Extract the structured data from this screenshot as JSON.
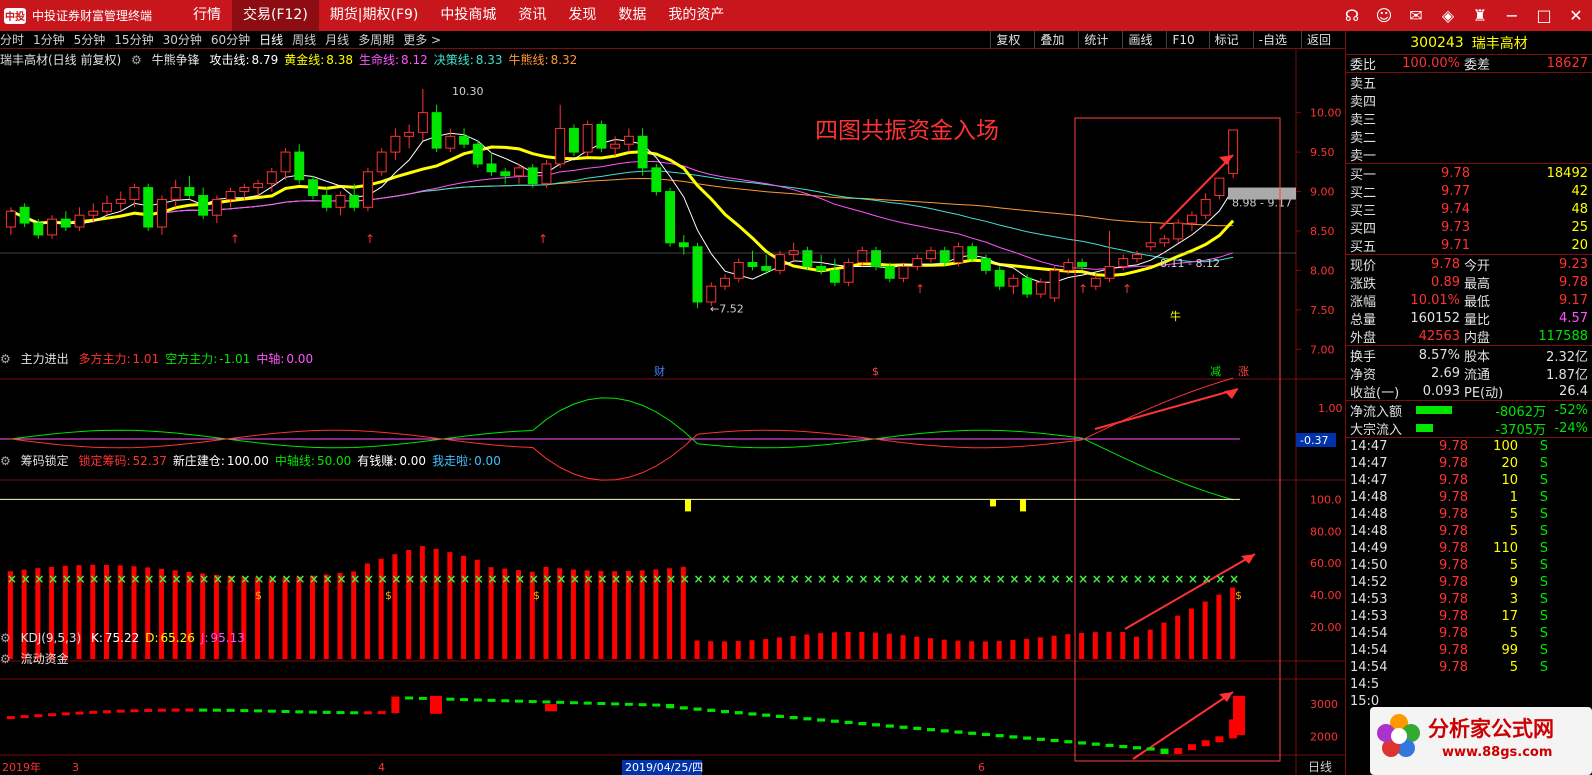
{
  "app": {
    "title": "中投证券财富管理终端",
    "menu": [
      "行情",
      "交易(F12)",
      "期货|期权(F9)",
      "中投商城",
      "资讯",
      "发现",
      "数据",
      "我的资产"
    ],
    "active_menu": 1
  },
  "timeframes": [
    "分时",
    "1分钟",
    "5分钟",
    "15分钟",
    "30分钟",
    "60分钟",
    "日线",
    "周线",
    "月线",
    "多周期",
    "更多 >"
  ],
  "selected_timeframe": "日线",
  "tools": [
    "复权",
    "叠加",
    "统计",
    "画线",
    "F10",
    "标记",
    "-自选",
    "返回"
  ],
  "main_panel": {
    "title": "瑞丰高材(日线 前复权)",
    "indicator": "牛熊争锋",
    "lines": [
      {
        "label": "攻击线:",
        "value": "8.79",
        "color": "#ffffff"
      },
      {
        "label": "黄金线:",
        "value": "8.38",
        "color": "#ffff00"
      },
      {
        "label": "生命线:",
        "value": "8.12",
        "color": "#ff55ff"
      },
      {
        "label": "决策线:",
        "value": "8.33",
        "color": "#40e0d0"
      },
      {
        "label": "牛熊线:",
        "value": "8.32",
        "color": "#ff9933"
      }
    ],
    "annotation": "四图共振资金入场",
    "high_label": "10.30",
    "low_label": "7.52",
    "range1": "8.98 - 9.17",
    "range2": "8.11 - 8.12",
    "marks": [
      "财",
      "$",
      "减",
      "涨",
      "牛"
    ],
    "yticks": [
      "10.00",
      "9.50",
      "9.00",
      "8.50",
      "8.00",
      "7.50",
      "7.00"
    ]
  },
  "panel2": {
    "title": "主力进出",
    "items": [
      {
        "label": "多方主力:",
        "value": "1.01",
        "color": "#ff3232"
      },
      {
        "label": "空方主力:",
        "value": "-1.01",
        "color": "#00e600"
      },
      {
        "label": "中轴:",
        "value": "0.00",
        "color": "#ff55ff"
      }
    ],
    "yticks": [
      "1.00",
      "-0.37"
    ]
  },
  "panel3": {
    "title": "筹码锁定",
    "items": [
      {
        "label": "锁定筹码:",
        "value": "52.37",
        "color": "#ff3232"
      },
      {
        "label": "新庄建仓:",
        "value": "100.00",
        "color": "#ffffff"
      },
      {
        "label": "中轴线:",
        "value": "50.00",
        "color": "#00e600"
      },
      {
        "label": "有钱赚:",
        "value": "0.00",
        "color": "#ffffff"
      },
      {
        "label": "我走啦:",
        "value": "0.00",
        "color": "#40c0ff"
      }
    ],
    "yticks": [
      "100.0",
      "80.00",
      "60.00",
      "40.00",
      "20.00"
    ]
  },
  "panel4": {
    "title": "KDJ(9,5,3)",
    "items": [
      {
        "label": "K:",
        "value": "75.22",
        "color": "#ffffff"
      },
      {
        "label": "D:",
        "value": "65.26",
        "color": "#ffff00"
      },
      {
        "label": "J:",
        "value": "95.13",
        "color": "#ff55ff"
      }
    ]
  },
  "panel5": {
    "title": "流动资金",
    "yticks": [
      "3000",
      "2000"
    ]
  },
  "xaxis": {
    "labels": [
      "2019年",
      "3",
      "4",
      "2019/04/25/四",
      "6"
    ],
    "period": "日线"
  },
  "quote": {
    "code": "300243",
    "name": "瑞丰高材",
    "weibi": {
      "label": "委比",
      "value": "100.00%",
      "label2": "委差",
      "value2": "18627"
    },
    "asks": [
      "卖五",
      "卖四",
      "卖三",
      "卖二",
      "卖一"
    ],
    "bids": [
      {
        "label": "买一",
        "price": "9.78",
        "vol": "18492"
      },
      {
        "label": "买二",
        "price": "9.77",
        "vol": "42"
      },
      {
        "label": "买三",
        "price": "9.74",
        "vol": "48"
      },
      {
        "label": "买四",
        "price": "9.73",
        "vol": "25"
      },
      {
        "label": "买五",
        "price": "9.71",
        "vol": "20"
      }
    ],
    "stats": [
      {
        "l1": "现价",
        "v1": "9.78",
        "c1": "red",
        "l2": "今开",
        "v2": "9.23",
        "c2": "red"
      },
      {
        "l1": "涨跌",
        "v1": "0.89",
        "c1": "red",
        "l2": "最高",
        "v2": "9.78",
        "c2": "red"
      },
      {
        "l1": "涨幅",
        "v1": "10.01%",
        "c1": "red",
        "l2": "最低",
        "v2": "9.17",
        "c2": "red"
      },
      {
        "l1": "总量",
        "v1": "160152",
        "c1": "white",
        "l2": "量比",
        "v2": "4.57",
        "c2": "purple"
      },
      {
        "l1": "外盘",
        "v1": "42563",
        "c1": "red",
        "l2": "内盘",
        "v2": "117588",
        "c2": "green"
      }
    ],
    "stats2": [
      {
        "l1": "换手",
        "v1": "8.57%",
        "l2": "股本",
        "v2": "2.32亿"
      },
      {
        "l1": "净资",
        "v1": "2.69",
        "l2": "流通",
        "v2": "1.87亿"
      },
      {
        "l1": "收益(一)",
        "v1": "0.093",
        "l2": "PE(动)",
        "v2": "26.4"
      }
    ],
    "flows": [
      {
        "label": "净流入额",
        "value": "-8062万",
        "pct": "-52%",
        "bar": 0.52
      },
      {
        "label": "大宗流入",
        "value": "-3705万",
        "pct": "-24%",
        "bar": 0.24
      }
    ],
    "ticks": [
      {
        "t": "14:47",
        "p": "9.78",
        "v": "100",
        "s": "S"
      },
      {
        "t": "14:47",
        "p": "9.78",
        "v": "20",
        "s": "S"
      },
      {
        "t": "14:47",
        "p": "9.78",
        "v": "10",
        "s": "S"
      },
      {
        "t": "14:48",
        "p": "9.78",
        "v": "1",
        "s": "S"
      },
      {
        "t": "14:48",
        "p": "9.78",
        "v": "5",
        "s": "S"
      },
      {
        "t": "14:48",
        "p": "9.78",
        "v": "5",
        "s": "S"
      },
      {
        "t": "14:49",
        "p": "9.78",
        "v": "110",
        "s": "S"
      },
      {
        "t": "14:50",
        "p": "9.78",
        "v": "5",
        "s": "S"
      },
      {
        "t": "14:52",
        "p": "9.78",
        "v": "9",
        "s": "S"
      },
      {
        "t": "14:53",
        "p": "9.78",
        "v": "3",
        "s": "S"
      },
      {
        "t": "14:53",
        "p": "9.78",
        "v": "17",
        "s": "S"
      },
      {
        "t": "14:54",
        "p": "9.78",
        "v": "5",
        "s": "S"
      },
      {
        "t": "14:54",
        "p": "9.78",
        "v": "99",
        "s": "S"
      },
      {
        "t": "14:54",
        "p": "9.78",
        "v": "5",
        "s": "S"
      },
      {
        "t": "14:5",
        "p": "",
        "v": "",
        "s": ""
      },
      {
        "t": "15:0",
        "p": "",
        "v": "",
        "s": ""
      }
    ]
  },
  "watermark": {
    "text": "分析家公式网",
    "url": "www.88gs.com"
  },
  "chart_data": {
    "type": "candlestick",
    "ohlc": [
      [
        8.55,
        8.8,
        8.45,
        8.75
      ],
      [
        8.8,
        8.85,
        8.55,
        8.6
      ],
      [
        8.6,
        8.65,
        8.4,
        8.45
      ],
      [
        8.45,
        8.7,
        8.4,
        8.65
      ],
      [
        8.65,
        8.75,
        8.5,
        8.55
      ],
      [
        8.55,
        8.8,
        8.5,
        8.7
      ],
      [
        8.7,
        8.85,
        8.6,
        8.75
      ],
      [
        8.75,
        8.95,
        8.7,
        8.85
      ],
      [
        8.85,
        9.0,
        8.75,
        8.9
      ],
      [
        8.9,
        9.1,
        8.8,
        9.05
      ],
      [
        9.05,
        9.1,
        8.5,
        8.55
      ],
      [
        8.55,
        8.95,
        8.45,
        8.9
      ],
      [
        8.9,
        9.15,
        8.8,
        9.05
      ],
      [
        9.05,
        9.2,
        8.9,
        8.95
      ],
      [
        8.95,
        9.05,
        8.65,
        8.7
      ],
      [
        8.7,
        8.95,
        8.6,
        8.9
      ],
      [
        8.9,
        9.05,
        8.8,
        9.0
      ],
      [
        9.0,
        9.1,
        8.9,
        9.05
      ],
      [
        9.05,
        9.15,
        8.95,
        9.1
      ],
      [
        9.1,
        9.3,
        9.0,
        9.25
      ],
      [
        9.25,
        9.55,
        9.15,
        9.5
      ],
      [
        9.5,
        9.6,
        9.1,
        9.15
      ],
      [
        9.15,
        9.2,
        8.9,
        8.95
      ],
      [
        8.95,
        9.05,
        8.75,
        8.8
      ],
      [
        8.8,
        9.0,
        8.7,
        8.95
      ],
      [
        8.95,
        9.1,
        8.75,
        8.8
      ],
      [
        8.8,
        9.3,
        8.75,
        9.25
      ],
      [
        9.25,
        9.55,
        9.2,
        9.5
      ],
      [
        9.5,
        9.8,
        9.4,
        9.7
      ],
      [
        9.7,
        9.85,
        9.55,
        9.75
      ],
      [
        9.75,
        10.3,
        9.65,
        10.0
      ],
      [
        10.0,
        10.1,
        9.5,
        9.55
      ],
      [
        9.55,
        9.8,
        9.5,
        9.7
      ],
      [
        9.7,
        9.8,
        9.55,
        9.6
      ],
      [
        9.6,
        9.65,
        9.3,
        9.35
      ],
      [
        9.35,
        9.5,
        9.2,
        9.25
      ],
      [
        9.25,
        9.3,
        9.1,
        9.2
      ],
      [
        9.2,
        9.35,
        9.1,
        9.3
      ],
      [
        9.3,
        9.35,
        9.05,
        9.1
      ],
      [
        9.1,
        9.4,
        9.05,
        9.35
      ],
      [
        9.35,
        10.1,
        9.3,
        9.8
      ],
      [
        9.8,
        9.85,
        9.45,
        9.5
      ],
      [
        9.5,
        9.9,
        9.45,
        9.85
      ],
      [
        9.85,
        9.9,
        9.5,
        9.55
      ],
      [
        9.55,
        9.7,
        9.45,
        9.6
      ],
      [
        9.6,
        9.8,
        9.5,
        9.7
      ],
      [
        9.7,
        9.8,
        9.2,
        9.3
      ],
      [
        9.3,
        9.35,
        8.95,
        9.0
      ],
      [
        9.0,
        9.05,
        8.3,
        8.35
      ],
      [
        8.35,
        8.45,
        8.2,
        8.3
      ],
      [
        8.3,
        8.35,
        7.52,
        7.6
      ],
      [
        7.6,
        7.85,
        7.55,
        7.8
      ],
      [
        7.8,
        7.95,
        7.75,
        7.9
      ],
      [
        7.9,
        8.15,
        7.85,
        8.1
      ],
      [
        8.1,
        8.25,
        8.0,
        8.05
      ],
      [
        8.05,
        8.2,
        7.95,
        8.0
      ],
      [
        8.0,
        8.25,
        7.95,
        8.2
      ],
      [
        8.2,
        8.35,
        8.1,
        8.25
      ],
      [
        8.25,
        8.3,
        8.0,
        8.05
      ],
      [
        8.05,
        8.2,
        7.95,
        8.0
      ],
      [
        8.0,
        8.15,
        7.8,
        7.85
      ],
      [
        7.85,
        8.15,
        7.8,
        8.1
      ],
      [
        8.1,
        8.3,
        8.05,
        8.25
      ],
      [
        8.25,
        8.3,
        8.0,
        8.05
      ],
      [
        8.05,
        8.1,
        7.85,
        7.9
      ],
      [
        7.9,
        8.1,
        7.85,
        8.05
      ],
      [
        8.05,
        8.2,
        8.0,
        8.15
      ],
      [
        8.15,
        8.3,
        8.1,
        8.25
      ],
      [
        8.25,
        8.3,
        8.05,
        8.1
      ],
      [
        8.1,
        8.35,
        8.05,
        8.3
      ],
      [
        8.3,
        8.35,
        8.1,
        8.15
      ],
      [
        8.15,
        8.2,
        7.95,
        8.0
      ],
      [
        8.0,
        8.05,
        7.75,
        7.8
      ],
      [
        7.8,
        7.95,
        7.7,
        7.9
      ],
      [
        7.9,
        7.95,
        7.65,
        7.7
      ],
      [
        7.7,
        7.9,
        7.65,
        7.85
      ],
      [
        7.65,
        8.05,
        7.6,
        8.0
      ],
      [
        8.0,
        8.15,
        7.95,
        8.1
      ],
      [
        8.1,
        8.15,
        8.0,
        8.05
      ],
      [
        7.8,
        7.95,
        7.75,
        7.9
      ],
      [
        7.9,
        8.5,
        7.85,
        8.05
      ],
      [
        8.05,
        8.2,
        8.0,
        8.15
      ],
      [
        8.15,
        8.25,
        8.1,
        8.2
      ],
      [
        8.3,
        8.6,
        8.25,
        8.35
      ],
      [
        8.35,
        8.45,
        8.3,
        8.4
      ],
      [
        8.4,
        8.65,
        8.35,
        8.6
      ],
      [
        8.6,
        8.75,
        8.5,
        8.7
      ],
      [
        8.7,
        8.98,
        8.65,
        8.9
      ],
      [
        8.95,
        9.17,
        8.9,
        9.17
      ],
      [
        9.23,
        9.78,
        9.17,
        9.78
      ]
    ]
  }
}
